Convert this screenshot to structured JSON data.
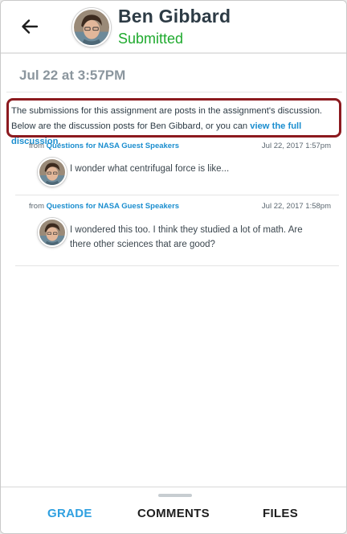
{
  "header": {
    "student_name": "Ben Gibbard",
    "status": "Submitted",
    "status_color": "#1faa2e",
    "back_icon": "arrow-left-icon",
    "avatar_icon": "student-avatar"
  },
  "submission": {
    "date": "Jul 22 at 3:57PM"
  },
  "notice": {
    "text": "The submissions for this assignment are posts in the assignment's discussion. Below are the discussion posts for Ben Gibbard, or you can ",
    "link": "view the full discussion",
    "end": ".",
    "highlight_color": "#8c1a1f"
  },
  "posts": [
    {
      "from_label": "from",
      "topic": "Questions for NASA Guest Speakers",
      "date": "Jul 22, 2017 1:57pm",
      "body": "I wonder what centrifugal force is like..."
    },
    {
      "from_label": "from",
      "topic": "Questions for NASA Guest Speakers",
      "date": "Jul 22, 2017 1:58pm",
      "body": "I wondered this too. I think they studied a lot of math. Are there other sciences that are good?"
    }
  ],
  "tabs": {
    "grade": "GRADE",
    "comments": "COMMENTS",
    "files": "FILES",
    "active_color": "#2fa0e0"
  }
}
